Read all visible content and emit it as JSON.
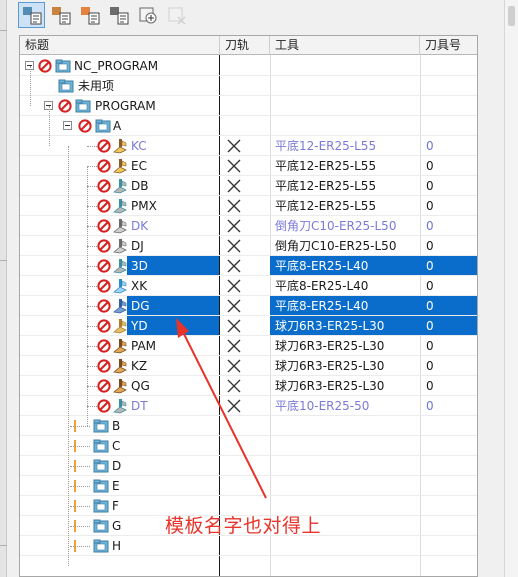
{
  "header": {
    "col_title": "标题",
    "col_path": "刀轨",
    "col_tool": "工具",
    "col_tool_num": "刀具号"
  },
  "toolbar": {
    "buttons": [
      {
        "icon": "program-order-view-icon",
        "active": true
      },
      {
        "icon": "machine-tool-view-icon",
        "active": false
      },
      {
        "icon": "geometry-view-icon",
        "active": false
      },
      {
        "icon": "machining-method-view-icon",
        "active": false
      },
      {
        "icon": "create-group-icon",
        "active": false
      },
      {
        "icon": "delete-icon",
        "active": false,
        "disabled": true
      }
    ]
  },
  "colors": {
    "selection": "#0a6dcb",
    "link_blue": "#7a7ad9",
    "annotation_red": "#e8342a"
  },
  "tree": {
    "root": "NC_PROGRAM",
    "unused": "未用项",
    "program": "PROGRAM",
    "group_a": "A",
    "operations": [
      {
        "name": "KC",
        "tool": "平底12-ER25-L55",
        "num": "0",
        "blue": true,
        "selected": false,
        "icon": "cavity-mill-icon"
      },
      {
        "name": "EC",
        "tool": "平底12-ER25-L55",
        "num": "0",
        "blue": false,
        "selected": false,
        "icon": "cavity-mill-icon"
      },
      {
        "name": "DB",
        "tool": "平底12-ER25-L55",
        "num": "0",
        "blue": false,
        "selected": false,
        "icon": "floor-wall-icon"
      },
      {
        "name": "PMX",
        "tool": "平底12-ER25-L55",
        "num": "0",
        "blue": false,
        "selected": false,
        "icon": "floor-wall-icon"
      },
      {
        "name": "DK",
        "tool": "倒角刀C10-ER25-L50",
        "num": "0",
        "blue": true,
        "selected": false,
        "icon": "chamfer-icon"
      },
      {
        "name": "DJ",
        "tool": "倒角刀C10-ER25-L50",
        "num": "0",
        "blue": false,
        "selected": false,
        "icon": "chamfer-icon"
      },
      {
        "name": "3D",
        "tool": "平底8-ER25-L40",
        "num": "0",
        "blue": false,
        "selected": true,
        "icon": "floor-wall-icon"
      },
      {
        "name": "XK",
        "tool": "平底8-ER25-L40",
        "num": "0",
        "blue": false,
        "selected": false,
        "icon": "planar-mill-icon"
      },
      {
        "name": "DG",
        "tool": "平底8-ER25-L40",
        "num": "0",
        "blue": false,
        "selected": true,
        "icon": "zlevel-icon"
      },
      {
        "name": "YD",
        "tool": "球刀6R3-ER25-L30",
        "num": "0",
        "blue": false,
        "selected": true,
        "icon": "fixed-contour-icon"
      },
      {
        "name": "PAM",
        "tool": "球刀6R3-ER25-L30",
        "num": "0",
        "blue": false,
        "selected": false,
        "icon": "contour-icon"
      },
      {
        "name": "KZ",
        "tool": "球刀6R3-ER25-L30",
        "num": "0",
        "blue": false,
        "selected": false,
        "icon": "contour-icon"
      },
      {
        "name": "QG",
        "tool": "球刀6R3-ER25-L30",
        "num": "0",
        "blue": false,
        "selected": false,
        "icon": "contour-icon"
      },
      {
        "name": "DT",
        "tool": "平底10-ER25-50",
        "num": "0",
        "blue": true,
        "selected": false,
        "icon": "floor-wall-icon"
      }
    ],
    "groups": [
      "B",
      "C",
      "D",
      "E",
      "F",
      "G",
      "H"
    ]
  },
  "annotation": {
    "text": "模板名字也对得上"
  }
}
